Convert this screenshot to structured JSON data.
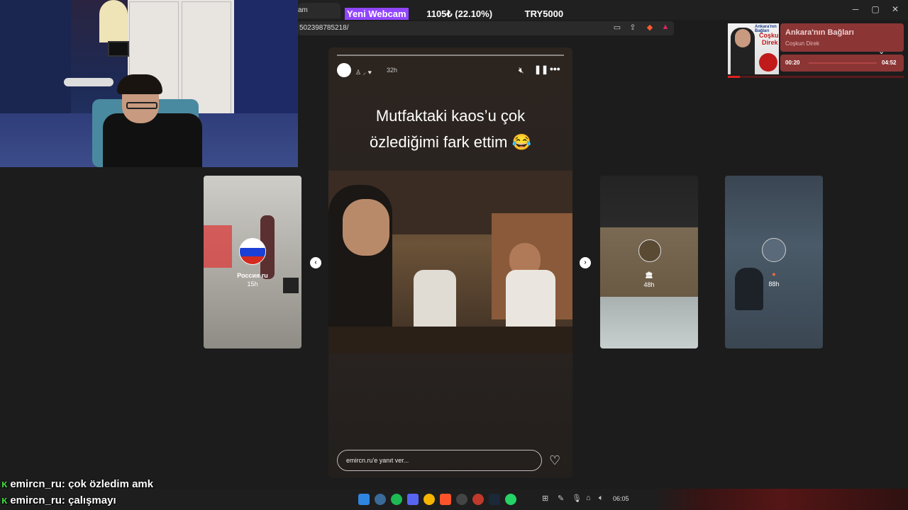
{
  "overlay": {
    "webcam_label": "Yeni Webcam",
    "stat_a": "1105₺ (22.10%)",
    "stat_b": "TRY5000"
  },
  "browser": {
    "tab_title": "am",
    "url": "502398785218/"
  },
  "story": {
    "time_ago": "32h",
    "caption_line1": "Mutfaktaki kaos’u çok",
    "caption_line2": "özlediğimi fark ettim 😂",
    "reply_placeholder": "emircn.ru'e yanıt ver..."
  },
  "side_stories": [
    {
      "title": "Россия ru",
      "time": "15h"
    },
    {
      "title": "",
      "time": "48h"
    },
    {
      "title": "",
      "time": "88h"
    }
  ],
  "music": {
    "title": "Ankara'nın Bağları",
    "artist": "Coşkun Direk",
    "elapsed": "00:20",
    "duration": "04:52",
    "progress": 0.07,
    "album_text_1": "Ankara'nın Bağları",
    "album_text_2": "Coşkun",
    "album_text_3": "Direk"
  },
  "chat": [
    {
      "user": "emircn_ru",
      "message": "çok özledim amk"
    },
    {
      "user": "emircn_ru",
      "message": "çalışmayı"
    }
  ],
  "taskbar": {
    "clock": "06:05"
  },
  "colors": {
    "twitch_purple": "#9146ff",
    "music_red": "#8c3535",
    "chat_badge": "#40d040"
  }
}
